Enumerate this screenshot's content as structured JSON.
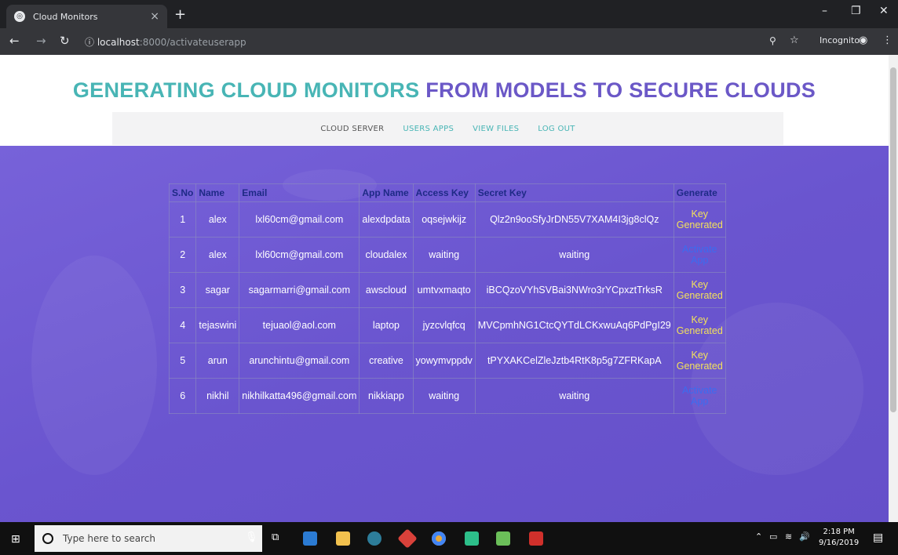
{
  "browser": {
    "tab_title": "Cloud Monitors",
    "tab_close": "×",
    "new_tab": "+",
    "url_host": "localhost",
    "url_path": ":8000/activateuserapp",
    "incognito_label": "Incognito"
  },
  "page": {
    "heading_part1": "GENERATING CLOUD MONITORS",
    "heading_part2": "FROM MODELS TO SECURE CLOUDS",
    "nav": [
      "CLOUD SERVER",
      "USERS APPS",
      "VIEW FILES",
      "LOG OUT"
    ]
  },
  "table": {
    "headers": [
      "S.No",
      "Name",
      "Email",
      "App Name",
      "Access Key",
      "Secret Key",
      "Generate"
    ],
    "rows": [
      {
        "sno": "1",
        "name": "alex",
        "email": "lxl60cm@gmail.com",
        "app": "alexdpdata",
        "access": "oqsejwkijz",
        "secret": "Qlz2n9ooSfyJrDN55V7XAM4I3jg8clQz",
        "generate": "Key Generated",
        "generate_type": "key"
      },
      {
        "sno": "2",
        "name": "alex",
        "email": "lxl60cm@gmail.com",
        "app": "cloudalex",
        "access": "waiting",
        "secret": "waiting",
        "generate": "Activate App",
        "generate_type": "activate"
      },
      {
        "sno": "3",
        "name": "sagar",
        "email": "sagarmarri@gmail.com",
        "app": "awscloud",
        "access": "umtvxmaqto",
        "secret": "iBCQzoVYhSVBai3NWro3rYCpxztTrksR",
        "generate": "Key Generated",
        "generate_type": "key"
      },
      {
        "sno": "4",
        "name": "tejaswini",
        "email": "tejuaol@aol.com",
        "app": "laptop",
        "access": "jyzcvlqfcq",
        "secret": "MVCpmhNG1CtcQYTdLCKxwuAq6PdPgI29",
        "generate": "Key Generated",
        "generate_type": "key"
      },
      {
        "sno": "5",
        "name": "arun",
        "email": "arunchintu@gmail.com",
        "app": "creative",
        "access": "yowymvppdv",
        "secret": "tPYXAKCelZleJztb4RtK8p5g7ZFRKapA",
        "generate": "Key Generated",
        "generate_type": "key"
      },
      {
        "sno": "6",
        "name": "nikhil",
        "email": "nikhilkatta496@gmail.com",
        "app": "nikkiapp",
        "access": "waiting",
        "secret": "waiting",
        "generate": "Activate App",
        "generate_type": "activate"
      }
    ]
  },
  "taskbar": {
    "search_placeholder": "Type here to search",
    "time": "2:18 PM",
    "date": "9/16/2019"
  }
}
